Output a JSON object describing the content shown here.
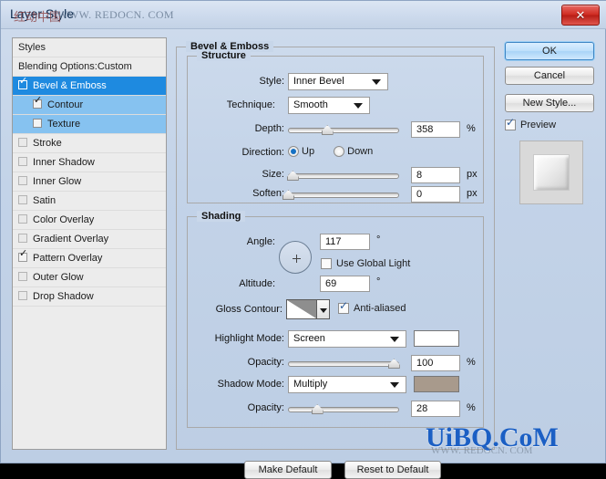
{
  "window": {
    "title": "Layer Style",
    "watermark_cn": "红动中国",
    "watermark_url": "WWW. REDOCN. COM",
    "close_icon": "✕"
  },
  "styles_panel": {
    "header": "Styles",
    "blending_options": "Blending Options:Custom",
    "items": [
      {
        "label": "Bevel & Emboss",
        "checked": true,
        "selected": true,
        "sub": false
      },
      {
        "label": "Contour",
        "checked": true,
        "selected": false,
        "sub": true
      },
      {
        "label": "Texture",
        "checked": false,
        "selected": false,
        "sub": true
      },
      {
        "label": "Stroke",
        "checked": false,
        "selected": false,
        "sub": false
      },
      {
        "label": "Inner Shadow",
        "checked": false,
        "selected": false,
        "sub": false
      },
      {
        "label": "Inner Glow",
        "checked": false,
        "selected": false,
        "sub": false
      },
      {
        "label": "Satin",
        "checked": false,
        "selected": false,
        "sub": false
      },
      {
        "label": "Color Overlay",
        "checked": false,
        "selected": false,
        "sub": false
      },
      {
        "label": "Gradient Overlay",
        "checked": false,
        "selected": false,
        "sub": false
      },
      {
        "label": "Pattern Overlay",
        "checked": true,
        "selected": false,
        "sub": false
      },
      {
        "label": "Outer Glow",
        "checked": false,
        "selected": false,
        "sub": false
      },
      {
        "label": "Drop Shadow",
        "checked": false,
        "selected": false,
        "sub": false
      }
    ]
  },
  "buttons": {
    "ok": "OK",
    "cancel": "Cancel",
    "new_style": "New Style...",
    "preview": "Preview",
    "preview_checked": true,
    "make_default": "Make Default",
    "reset_to_default": "Reset to Default"
  },
  "main": {
    "group_title": "Bevel & Emboss",
    "structure": {
      "title": "Structure",
      "style_label": "Style:",
      "style_value": "Inner Bevel",
      "technique_label": "Technique:",
      "technique_value": "Smooth",
      "depth_label": "Depth:",
      "depth_value": "358",
      "depth_unit": "%",
      "depth_pct": 35,
      "direction_label": "Direction:",
      "direction_up": "Up",
      "direction_down": "Down",
      "direction_selected": "Up",
      "size_label": "Size:",
      "size_value": "8",
      "size_unit": "px",
      "size_pct": 4,
      "soften_label": "Soften:",
      "soften_value": "0",
      "soften_unit": "px",
      "soften_pct": 0
    },
    "shading": {
      "title": "Shading",
      "angle_label": "Angle:",
      "angle_value": "117",
      "angle_unit": "°",
      "use_global_light_label": "Use Global Light",
      "use_global_light_checked": false,
      "altitude_label": "Altitude:",
      "altitude_value": "69",
      "altitude_unit": "°",
      "gloss_contour_label": "Gloss Contour:",
      "anti_aliased_label": "Anti-aliased",
      "anti_aliased_checked": true,
      "highlight_mode_label": "Highlight Mode:",
      "highlight_mode_value": "Screen",
      "highlight_color": "#ffffff",
      "highlight_opacity_label": "Opacity:",
      "highlight_opacity_value": "100",
      "highlight_opacity_unit": "%",
      "highlight_opacity_pct": 95,
      "shadow_mode_label": "Shadow Mode:",
      "shadow_mode_value": "Multiply",
      "shadow_color": "#a89a8c",
      "shadow_opacity_label": "Opacity:",
      "shadow_opacity_value": "28",
      "shadow_opacity_unit": "%",
      "shadow_opacity_pct": 26
    }
  },
  "watermark": {
    "bottom_main": "UiBQ.CoM",
    "bottom_sub": "WWW. REDOCN. COM"
  }
}
